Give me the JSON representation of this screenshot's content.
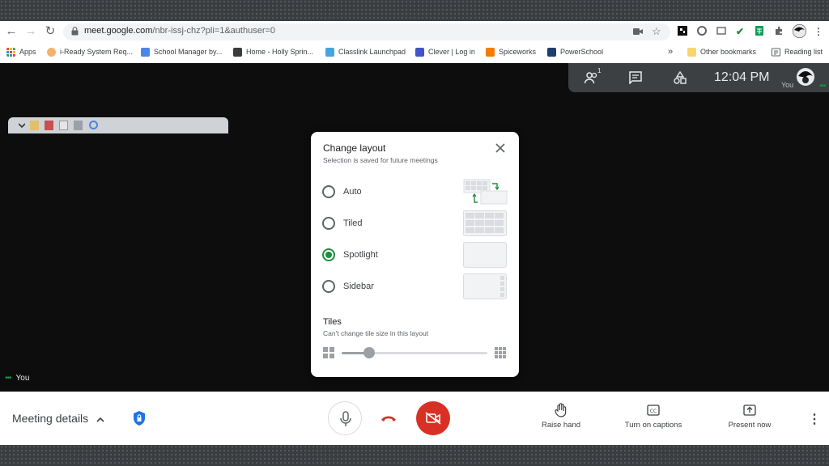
{
  "browser": {
    "url_host": "meet.google.com",
    "url_path": "/nbr-issj-chz?pli=1&authuser=0",
    "bookmarks": [
      {
        "label": "Apps",
        "color": "#ea4335"
      },
      {
        "label": "i-Ready System Req...",
        "color": "#f6b26b"
      },
      {
        "label": "School Manager by...",
        "color": "#4a86e8"
      },
      {
        "label": "Home - Holly Sprin...",
        "color": "#3c3c3c"
      },
      {
        "label": "Classlink Launchpad",
        "color": "#45a5e0"
      },
      {
        "label": "Clever | Log in",
        "color": "#4353c9"
      },
      {
        "label": "Spiceworks",
        "color": "#f57c00"
      },
      {
        "label": "PowerSchool",
        "color": "#1c3f6e"
      }
    ],
    "overflow_chevron": "»",
    "other_bookmarks": "Other bookmarks",
    "reading_list": "Reading list"
  },
  "meet": {
    "clock": "12:04 PM",
    "you_top": "You",
    "you_bottom": "You",
    "participants_badge": "1",
    "meeting_details": "Meeting details",
    "controls": {
      "raise_hand": "Raise hand",
      "captions": "Turn on captions",
      "present": "Present now"
    },
    "colors": {
      "end_call": "#d93025",
      "camera_off": "#d93025",
      "accent": "#1e8e3e"
    }
  },
  "dialog": {
    "title": "Change layout",
    "subtitle": "Selection is saved for future meetings",
    "options": [
      {
        "label": "Auto",
        "selected": false
      },
      {
        "label": "Tiled",
        "selected": false
      },
      {
        "label": "Spotlight",
        "selected": true
      },
      {
        "label": "Sidebar",
        "selected": false
      }
    ],
    "tiles_title": "Tiles",
    "tiles_subtitle": "Can't change tile size in this layout",
    "tile_slider_fraction": 0.19
  }
}
